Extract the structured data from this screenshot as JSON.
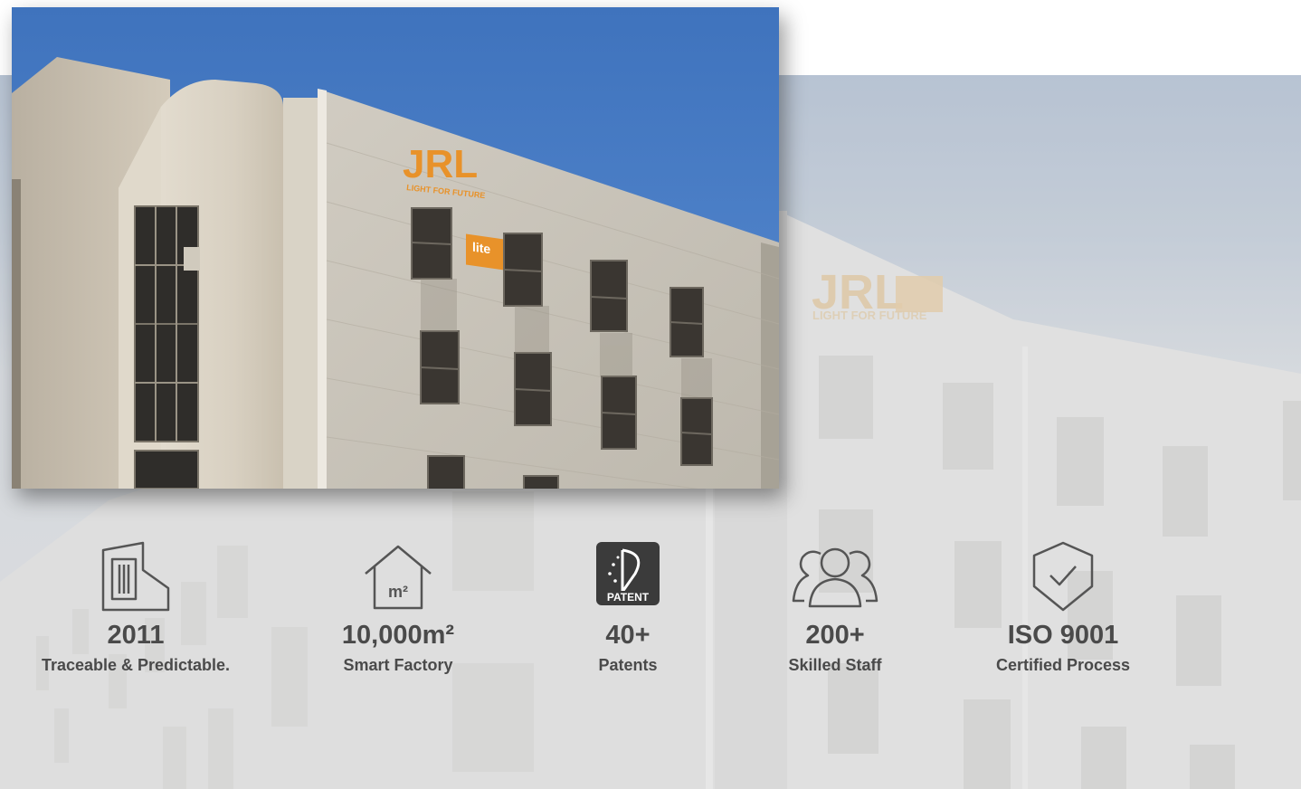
{
  "photo": {
    "sign_main": "JRL",
    "sign_badge": "lite",
    "sign_tagline": "LIGHT FOR FUTURE"
  },
  "stats": [
    {
      "value": "2011",
      "label": "Traceable & Predictable.",
      "icon": "factory-building-icon"
    },
    {
      "value": "10,000m²",
      "label": "Smart Factory",
      "icon": "house-area-icon",
      "icon_text": "m²"
    },
    {
      "value": "40+",
      "label": "Patents",
      "icon": "patent-badge-icon",
      "icon_text": "PATENT"
    },
    {
      "value": "200+",
      "label": "Skilled Staff",
      "icon": "people-group-icon"
    },
    {
      "value": "ISO 9001",
      "label": "Certified Process",
      "icon": "shield-check-icon"
    }
  ],
  "colors": {
    "text": "#4a4a4a",
    "sky": "#4a7ec4",
    "sign": "#e8922a",
    "icon_stroke": "#555555"
  }
}
